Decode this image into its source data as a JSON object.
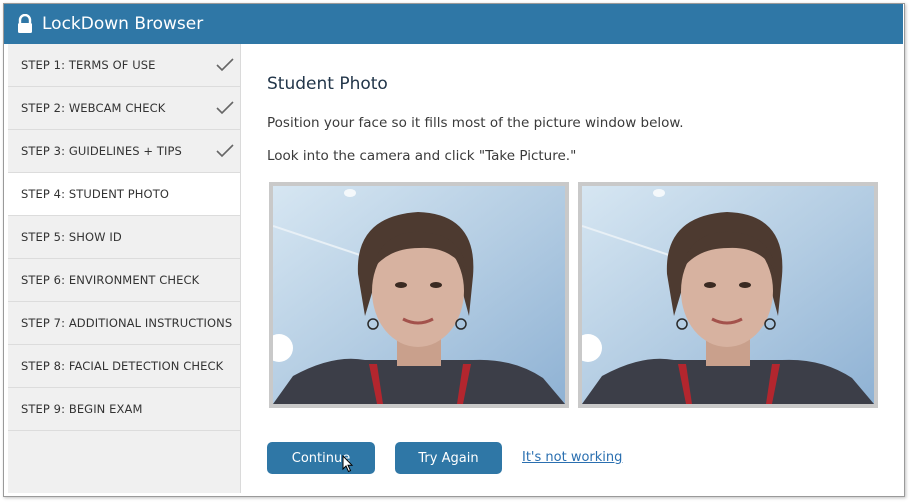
{
  "app": {
    "title": "LockDown Browser",
    "accent": "#2f77a6"
  },
  "sidebar": {
    "steps": [
      {
        "label": "STEP 1: TERMS OF USE",
        "completed": true
      },
      {
        "label": "STEP 2: WEBCAM CHECK",
        "completed": true
      },
      {
        "label": "STEP 3: GUIDELINES + TIPS",
        "completed": true
      },
      {
        "label": "STEP 4: STUDENT PHOTO",
        "active": true
      },
      {
        "label": "STEP 5: SHOW ID"
      },
      {
        "label": "STEP 6: ENVIRONMENT CHECK"
      },
      {
        "label": "STEP 7: ADDITIONAL INSTRUCTIONS"
      },
      {
        "label": "STEP 8: FACIAL DETECTION CHECK"
      },
      {
        "label": "STEP 9: BEGIN EXAM"
      }
    ]
  },
  "main": {
    "heading": "Student Photo",
    "instruction1": "Position your face so it fills most of the picture window below.",
    "instruction2": "Look into the camera and click \"Take Picture.\"",
    "photos": [
      "live-webcam-view",
      "captured-photo"
    ],
    "buttons": {
      "continue": "Continue",
      "try_again": "Try Again",
      "not_working": "It's not working"
    }
  },
  "icons": {
    "lock": "lock-icon",
    "check": "checkmark-icon",
    "cursor": "mouse-pointer-icon"
  }
}
